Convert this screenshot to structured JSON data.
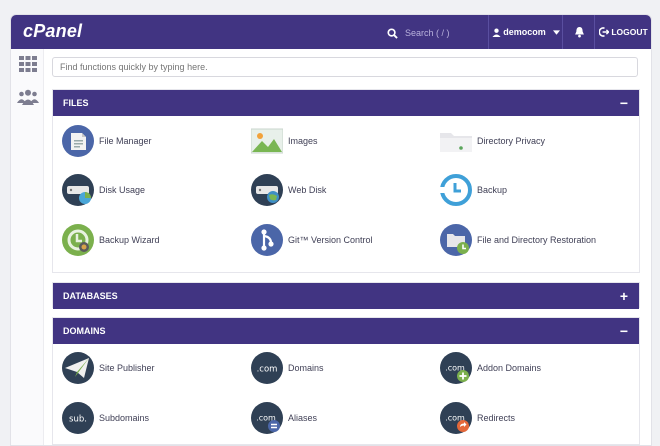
{
  "app": {
    "logo": "cPanel"
  },
  "search": {
    "placeholder": "Search ( / )"
  },
  "user": {
    "name": "democom"
  },
  "logout_label": "LOGOUT",
  "quick_find": {
    "placeholder": "Find functions quickly by typing here."
  },
  "sections": {
    "files": {
      "title": "FILES",
      "toggle": "−",
      "items": [
        {
          "label": "File Manager"
        },
        {
          "label": "Images"
        },
        {
          "label": "Directory Privacy"
        },
        {
          "label": "Disk Usage"
        },
        {
          "label": "Web Disk"
        },
        {
          "label": "Backup"
        },
        {
          "label": "Backup Wizard"
        },
        {
          "label": "Git™ Version Control"
        },
        {
          "label": "File and Directory Restoration"
        }
      ]
    },
    "databases": {
      "title": "DATABASES",
      "toggle": "+"
    },
    "domains": {
      "title": "DOMAINS",
      "toggle": "−",
      "items": [
        {
          "label": "Site Publisher"
        },
        {
          "label": "Domains"
        },
        {
          "label": "Addon Domains"
        },
        {
          "label": "Subdomains"
        },
        {
          "label": "Aliases"
        },
        {
          "label": "Redirects"
        }
      ],
      "badges": {
        "com": ".com",
        "sub": "sub."
      }
    }
  },
  "colors": {
    "brand": "#413482",
    "icon_dark": "#2f4055",
    "icon_blue": "#4b66a8",
    "icon_green": "#7bb04d"
  }
}
